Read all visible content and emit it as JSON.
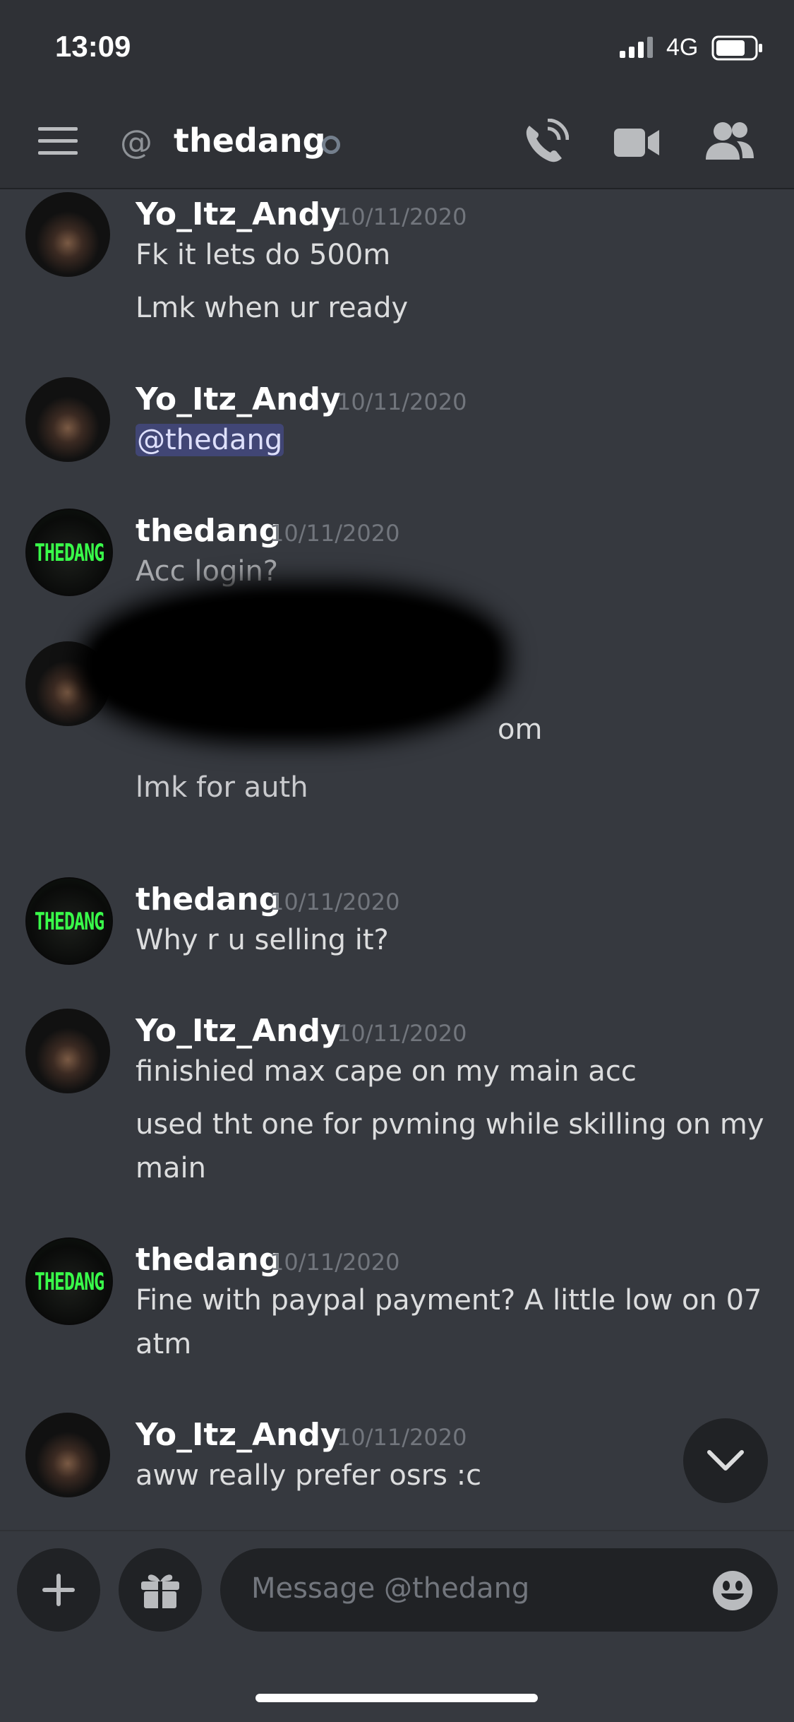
{
  "status_bar": {
    "time": "13:09",
    "network": "4G",
    "icons": [
      "signal-icon",
      "battery-icon"
    ]
  },
  "header": {
    "title": "thedang",
    "icons": [
      "menu-icon",
      "at-icon",
      "status-offline-icon",
      "voice-call-icon",
      "video-call-icon",
      "members-icon"
    ],
    "at_symbol": "@"
  },
  "messages": [
    {
      "author": "Yo_Itz_Andy",
      "timestamp": "10/11/2020",
      "lines": [
        "Fk it lets do 500m",
        "Lmk when ur ready"
      ]
    },
    {
      "author": "Yo_Itz_Andy",
      "timestamp": "10/11/2020",
      "mention": "@thedang"
    },
    {
      "author": "thedang",
      "timestamp": "10/11/2020",
      "lines": [
        "Acc login?"
      ]
    },
    {
      "author": "",
      "timestamp": "",
      "lines": [
        "om",
        "lmk for auth"
      ],
      "redacted": true
    },
    {
      "author": "thedang",
      "timestamp": "10/11/2020",
      "lines": [
        "Why r u selling it?"
      ]
    },
    {
      "author": "Yo_Itz_Andy",
      "timestamp": "10/11/2020",
      "lines": [
        "finishied max cape on my main acc",
        "used tht one for pvming while skilling on my",
        "main"
      ]
    },
    {
      "author": "thedang",
      "timestamp": "10/11/2020",
      "lines": [
        "Fine with paypal payment? A little low on 07",
        "atm"
      ]
    },
    {
      "author": "Yo_Itz_Andy",
      "timestamp": "10/11/2020",
      "lines": [
        "aww really prefer osrs :c"
      ]
    }
  ],
  "avatar_label": "THEDANG",
  "composer": {
    "placeholder": "Message @thedang",
    "icons": [
      "add-icon",
      "gift-icon",
      "emoji-icon",
      "chevron-down-icon"
    ]
  },
  "colors": {
    "background": "#36393f",
    "header": "#2f3136",
    "mention_bg": "#414675",
    "avatar_text": "#39ff4a"
  }
}
